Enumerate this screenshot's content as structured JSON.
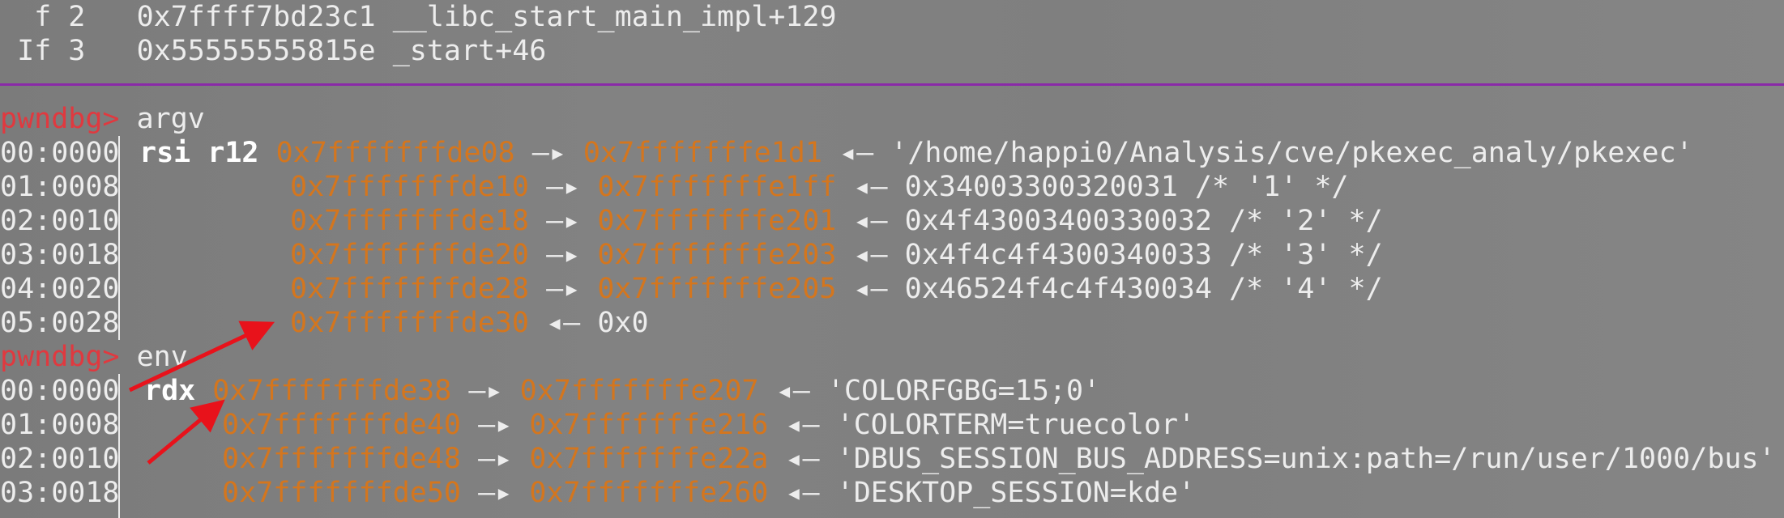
{
  "backtrace": [
    {
      "frame": "f 2",
      "addr": "0x7ffff7bd23c1",
      "symbol": "__libc_start_main_impl+129"
    },
    {
      "frame": "f 3",
      "addr": "0x55555555815e",
      "symbol": "_start+46"
    }
  ],
  "prompt": "pwndbg>",
  "argv_section": {
    "command": "argv",
    "rows": [
      {
        "offset": "00:0000",
        "regs": "rsi r12",
        "addr": "0x7fffffffde08",
        "arrow": "—▸",
        "target": "0x7fffffffe1d1",
        "arrow2": "◂—",
        "value": "'/home/happi0/Analysis/cve/pkexec_analy/pkexec'"
      },
      {
        "offset": "01:0008",
        "regs": "",
        "addr": "0x7fffffffde10",
        "arrow": "—▸",
        "target": "0x7fffffffe1ff",
        "arrow2": "◂—",
        "value": "0x34003300320031 /* '1' */"
      },
      {
        "offset": "02:0010",
        "regs": "",
        "addr": "0x7fffffffde18",
        "arrow": "—▸",
        "target": "0x7fffffffe201",
        "arrow2": "◂—",
        "value": "0x4f43003400330032 /* '2' */"
      },
      {
        "offset": "03:0018",
        "regs": "",
        "addr": "0x7fffffffde20",
        "arrow": "—▸",
        "target": "0x7fffffffe203",
        "arrow2": "◂—",
        "value": "0x4f4c4f4300340033 /* '3' */"
      },
      {
        "offset": "04:0020",
        "regs": "",
        "addr": "0x7fffffffde28",
        "arrow": "—▸",
        "target": "0x7fffffffe205",
        "arrow2": "◂—",
        "value": "0x46524f4c4f430034 /* '4' */"
      },
      {
        "offset": "05:0028",
        "regs": "",
        "addr": "0x7fffffffde30",
        "arrow2": "◂—",
        "value": "0x0"
      }
    ]
  },
  "env_section": {
    "command": "env",
    "rows": [
      {
        "offset": "00:0000",
        "regs": "rdx",
        "addr": "0x7fffffffde38",
        "arrow": "—▸",
        "target": "0x7fffffffe207",
        "arrow2": "◂—",
        "value": "'COLORFGBG=15;0'"
      },
      {
        "offset": "01:0008",
        "regs": "",
        "addr": "0x7fffffffde40",
        "arrow": "—▸",
        "target": "0x7fffffffe216",
        "arrow2": "◂—",
        "value": "'COLORTERM=truecolor'"
      },
      {
        "offset": "02:0010",
        "regs": "",
        "addr": "0x7fffffffde48",
        "arrow": "—▸",
        "target": "0x7fffffffe22a",
        "arrow2": "◂—",
        "value": "'DBUS_SESSION_BUS_ADDRESS=unix:path=/run/user/1000/bus'"
      },
      {
        "offset": "03:0018",
        "regs": "",
        "addr": "0x7fffffffde50",
        "arrow": "—▸",
        "target": "0x7fffffffe260",
        "arrow2": "◂—",
        "value": "'DESKTOP_SESSION=kde'"
      }
    ]
  },
  "colors": {
    "background": "#7f7f7f",
    "text": "#ededed",
    "prompt": "#e0393f",
    "address": "#d4761e",
    "separator": "#8a2aa8",
    "annotation_arrow": "#e8121b"
  }
}
